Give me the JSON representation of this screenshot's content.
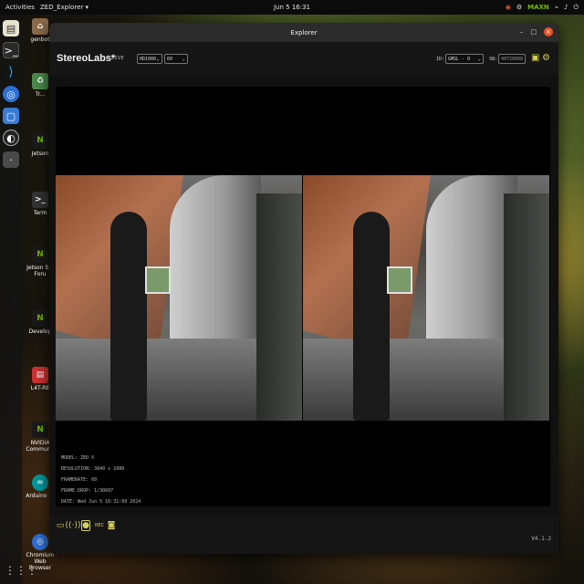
{
  "topbar": {
    "activities": "Activities",
    "app_name": "ZED_Explorer ▾",
    "clock": "Jun 5  16:31",
    "tray": [
      "◉",
      "⚙",
      "MAXN",
      "⌁",
      "♪",
      "⏻"
    ]
  },
  "dock": {
    "items": [
      "files-icon",
      "terminal-icon",
      "vscode-icon",
      "chromium-icon",
      "screenshot-icon",
      "obs-icon",
      "app-icon"
    ],
    "grid_icon": "⋮⋮⋮"
  },
  "desktop_icons": [
    {
      "label": "genbot",
      "icon": "home-icon"
    },
    {
      "label": "Tr...",
      "icon": "trash-icon"
    },
    {
      "label": "Jetson",
      "icon": "nvidia-icon"
    },
    {
      "label": "Term",
      "icon": "terminal-icon"
    },
    {
      "label": "Jetson S... Foru",
      "icon": "nvidia-icon"
    },
    {
      "label": "Develop",
      "icon": "nvidia-icon"
    },
    {
      "label": "L4T-RE",
      "icon": "doc-icon"
    },
    {
      "label": "NVIDIA Communit",
      "icon": "nvidia-icon"
    },
    {
      "label": "Arduino ID",
      "icon": "arduino-icon"
    },
    {
      "label": "Chromium Web Browser",
      "icon": "chromium-icon"
    }
  ],
  "window": {
    "title": "Explorer",
    "controls": {
      "minimize": "–",
      "maximize": "□",
      "close": "×"
    }
  },
  "app_header": {
    "brand": "StereoLabs*",
    "mode": "LIVE",
    "resolution_select": "HD1080",
    "fps_select": "60",
    "id_label": "ID:",
    "id_value": "GMSL - 0",
    "sn_label": "SN:",
    "sn_value": "40729908"
  },
  "metadata": {
    "model": "MODEL: ZED X",
    "resolution": "RESOLUTION: 3840 x 1080",
    "framerate": "FRAMERATE: 60",
    "frame_drop": "FRAME DROP: 1/30607",
    "date": "DATE: Wed Jun 5 16:31:09 2024"
  },
  "bottom_bar": {
    "icons": [
      "folder-icon",
      "broadcast-icon",
      "record-icon",
      "rec-label-icon",
      "camera-icon"
    ],
    "rec_label": "REC",
    "version": "V4.1.2"
  },
  "colors": {
    "accent": "#d6cf5a",
    "window_bg": "#111111",
    "titlebar": "#2b2b2b",
    "close": "#e95420"
  }
}
